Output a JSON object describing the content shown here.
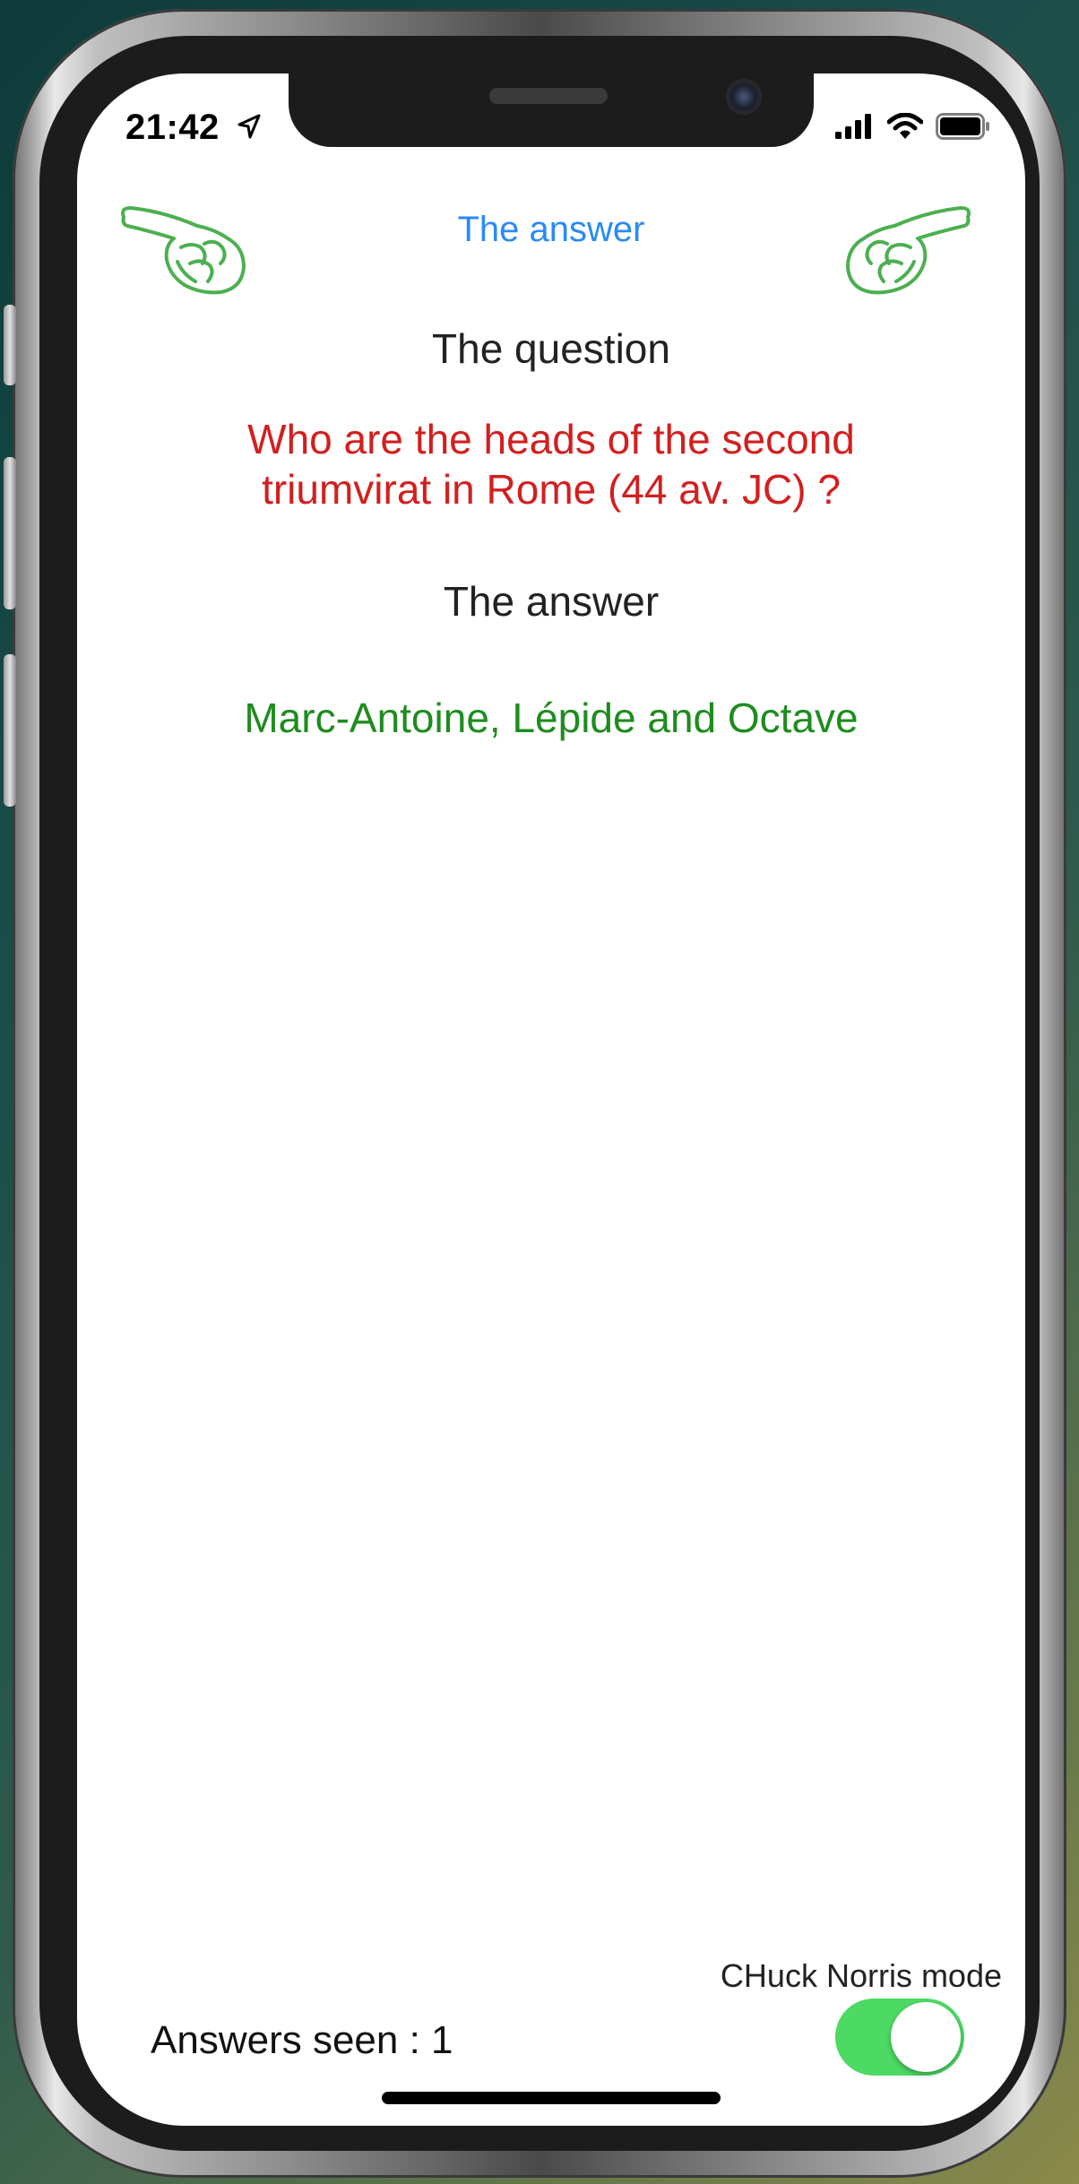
{
  "status_bar": {
    "time": "21:42",
    "location_icon": "location-arrow-icon",
    "signal_icon": "cellular-signal-icon",
    "wifi_icon": "wifi-icon",
    "battery_icon": "battery-icon"
  },
  "header": {
    "title": "The answer",
    "left_pointer_icon": "pointing-hand-left-icon",
    "right_pointer_icon": "pointing-hand-right-icon"
  },
  "question": {
    "label": "The question",
    "text": "Who are the heads of the second triumvirat in Rome (44 av. JC) ?"
  },
  "answer": {
    "label": "The answer",
    "text": "Marc-Antoine, Lépide and Octave"
  },
  "footer": {
    "mode_label": "CHuck Norris mode",
    "mode_enabled": true,
    "answers_seen": "Answers seen : 1"
  },
  "colors": {
    "link_blue": "#2a8af5",
    "question_red": "#d21f1f",
    "answer_green": "#1e8c1e",
    "toggle_green": "#4cd964",
    "pointer_green": "#4caf50"
  }
}
